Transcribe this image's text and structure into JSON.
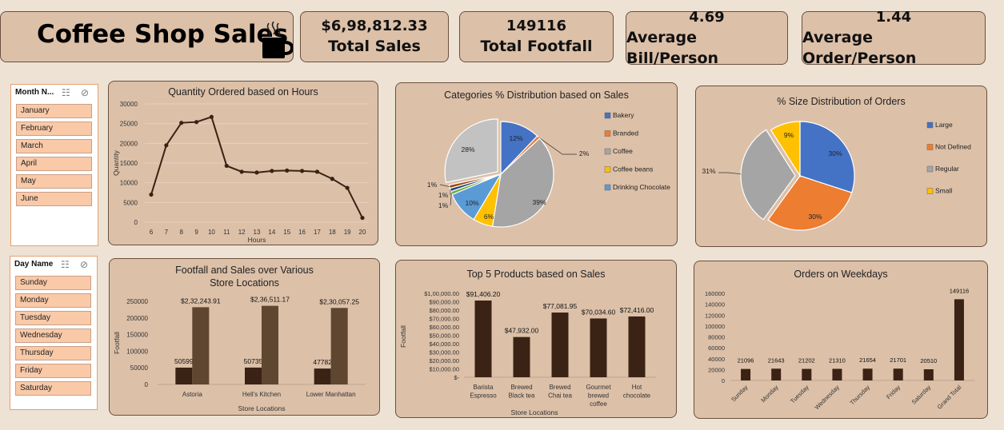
{
  "header": {
    "title": "Coffee Shop Sales",
    "icon": "coffee-cup-icon"
  },
  "kpis": [
    {
      "value": "$6,98,812.33",
      "label": "Total Sales"
    },
    {
      "value": "149116",
      "label": "Total Footfall"
    },
    {
      "value": "4.69",
      "label": "Average Bill/Person"
    },
    {
      "value": "1.44",
      "label": "Average Order/Person"
    }
  ],
  "slicer_month": {
    "header": "Month N...",
    "items": [
      "January",
      "February",
      "March",
      "April",
      "May",
      "June"
    ]
  },
  "slicer_day": {
    "header": "Day Name",
    "items": [
      "Sunday",
      "Monday",
      "Tuesday",
      "Wednesday",
      "Thursday",
      "Friday",
      "Saturday"
    ]
  },
  "colors": {
    "dark_brown": "#3a2314",
    "mid_brown": "#5e4630",
    "card_bg": "#dcc0a8",
    "page_bg": "#ede2d3"
  },
  "chart_data": [
    {
      "type": "line",
      "title": "Quantity Ordered based on Hours",
      "xlabel": "Hours",
      "ylabel": "Quantity",
      "x": [
        6,
        7,
        8,
        9,
        10,
        11,
        12,
        13,
        14,
        15,
        16,
        17,
        18,
        19,
        20
      ],
      "values": [
        7000,
        19500,
        25200,
        25400,
        26700,
        14300,
        12800,
        12600,
        13000,
        13100,
        13000,
        12800,
        11000,
        8700,
        1100
      ],
      "yticks": [
        0,
        5000,
        10000,
        15000,
        20000,
        25000,
        30000
      ],
      "ylim": [
        0,
        30000
      ],
      "color": "#3a2314"
    },
    {
      "type": "pie",
      "title": "Categories % Distribution based on Sales",
      "legend": [
        "Bakery",
        "Branded",
        "Coffee",
        "Coffee beans",
        "Drinking Chocolate"
      ],
      "slices": [
        {
          "name": "Bakery",
          "value": 12,
          "label": "12%",
          "color": "#4472c4"
        },
        {
          "name": "Branded",
          "value": 1,
          "label": "2%",
          "color": "#ed7d31"
        },
        {
          "name": "Coffee",
          "value": 39,
          "label": "39%",
          "color": "#a5a5a5"
        },
        {
          "name": "Coffee beans",
          "value": 6,
          "label": "6%",
          "color": "#ffc000"
        },
        {
          "name": "Drinking Chocolate",
          "value": 10,
          "label": "10%",
          "color": "#5b9bd5"
        },
        {
          "name": "",
          "value": 1,
          "label": "1%",
          "color": "#70ad47"
        },
        {
          "name": "",
          "value": 1,
          "label": "1%",
          "color": "#264478"
        },
        {
          "name": "",
          "value": 1,
          "label": "1%",
          "color": "#9e480e"
        },
        {
          "name": "",
          "value": 28,
          "label": "28%",
          "color": "#c2c2c2"
        }
      ]
    },
    {
      "type": "pie",
      "title": "% Size Distribution of Orders",
      "legend": [
        "Large",
        "Not Defined",
        "Regular",
        "Small"
      ],
      "slices": [
        {
          "name": "Large",
          "value": 30,
          "label": "30%",
          "color": "#4472c4"
        },
        {
          "name": "Not Defined",
          "value": 30,
          "label": "30%",
          "color": "#ed7d31"
        },
        {
          "name": "Regular",
          "value": 31,
          "label": "31%",
          "color": "#a5a5a5"
        },
        {
          "name": "Small",
          "value": 9,
          "label": "9%",
          "color": "#ffc000"
        }
      ]
    },
    {
      "type": "bar",
      "title": "Footfall and Sales over Various Store Locations",
      "xlabel": "Store Locations",
      "ylabel": "Footfall",
      "categories": [
        "Astoria",
        "Hell's Kitchen",
        "Lower Manhattan"
      ],
      "series": [
        {
          "values": [
            50599,
            50735,
            47782
          ],
          "labels": [
            "50599",
            "50735",
            "47782"
          ],
          "color": "#3a2314"
        },
        {
          "values": [
            232243.91,
            236511.17,
            230057.25
          ],
          "labels": [
            "$2,32,243.91",
            "$2,36,511.17",
            "$2,30,057.25"
          ],
          "color": "#5e4630"
        }
      ],
      "yticks": [
        0,
        50000,
        100000,
        150000,
        200000,
        250000
      ],
      "ylim": [
        0,
        250000
      ]
    },
    {
      "type": "bar",
      "title": "Top 5 Products based on Sales",
      "xlabel": "Store Locations",
      "ylabel": "Footfall",
      "categories": [
        [
          "Barista",
          "Espresso"
        ],
        [
          "Brewed",
          "Black tea"
        ],
        [
          "Brewed",
          "Chai tea"
        ],
        [
          "Gourmet",
          "brewed",
          "coffee"
        ],
        [
          "Hot",
          "chocolate"
        ]
      ],
      "values": [
        91406.2,
        47932.0,
        77081.95,
        70034.6,
        72416.0
      ],
      "labels": [
        "$91,406.20",
        "$47,932.00",
        "$77,081.95",
        "$70,034.60",
        "$72,416.00"
      ],
      "yticks": [
        0,
        10000,
        20000,
        30000,
        40000,
        50000,
        60000,
        70000,
        80000,
        90000,
        100000
      ],
      "ytick_labels": [
        "$-",
        "$10,000.00",
        "$20,000.00",
        "$30,000.00",
        "$40,000.00",
        "$50,000.00",
        "$60,000.00",
        "$70,000.00",
        "$80,000.00",
        "$90,000.00",
        "$1,00,000.00"
      ],
      "ylim": [
        0,
        100000
      ],
      "color": "#3a2314"
    },
    {
      "type": "bar",
      "title": "Orders on Weekdays",
      "categories": [
        "Sunday",
        "Monday",
        "Tuesday",
        "Wednesday",
        "Thursday",
        "Friday",
        "Saturday",
        "Grand Total"
      ],
      "values": [
        21096,
        21643,
        21202,
        21310,
        21654,
        21701,
        20510,
        149116
      ],
      "yticks": [
        0,
        20000,
        40000,
        60000,
        80000,
        100000,
        120000,
        140000,
        160000
      ],
      "ylim": [
        0,
        160000
      ],
      "color": "#3a2314"
    }
  ]
}
